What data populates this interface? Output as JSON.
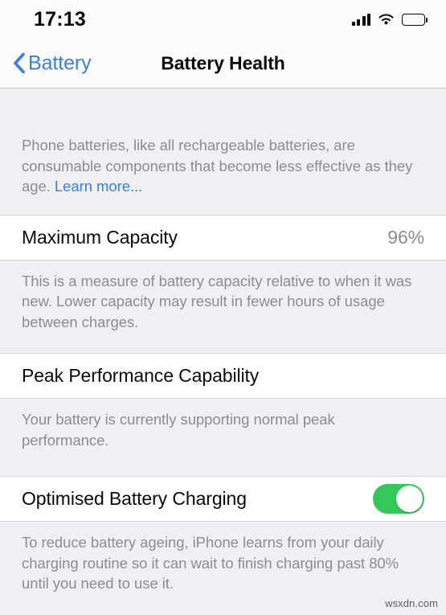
{
  "status_bar": {
    "time": "17:13",
    "signal_icon": "cellular-signal-icon",
    "wifi_icon": "wifi-icon",
    "battery_icon": "battery-icon",
    "battery_level_percent": 100
  },
  "nav": {
    "back_label": "Battery",
    "back_icon": "chevron-left-icon",
    "title": "Battery Health"
  },
  "intro": {
    "text": "Phone batteries, like all rechargeable batteries, are consumable components that become less effective as they age. ",
    "link_label": "Learn more..."
  },
  "sections": {
    "maximum_capacity": {
      "title": "Maximum Capacity",
      "value": "96%",
      "footer": "This is a measure of battery capacity relative to when it was new. Lower capacity may result in fewer hours of usage between charges."
    },
    "peak_performance": {
      "title": "Peak Performance Capability",
      "footer": "Your battery is currently supporting normal peak performance."
    },
    "optimised_charging": {
      "title": "Optimised Battery Charging",
      "toggle_state": "on",
      "footer": "To reduce battery ageing, iPhone learns from your daily charging routine so it can wait to finish charging past 80% until you need to use it."
    }
  },
  "watermark": {
    "text": "wsxdn.com"
  },
  "colors": {
    "accent_blue": "#3b7fe0",
    "toggle_green": "#34c759",
    "page_background": "#eff0f4",
    "cell_background": "#ffffff",
    "secondary_text": "#8c8c92"
  }
}
